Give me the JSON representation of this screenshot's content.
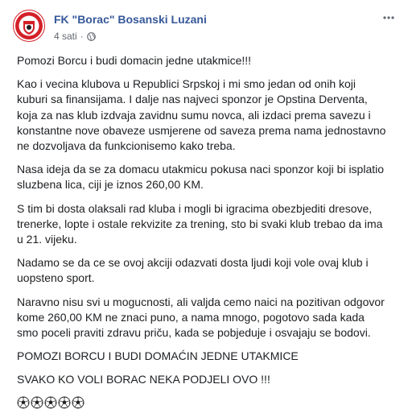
{
  "post": {
    "author": "FK \"Borac\" Bosanski Luzani",
    "time": "4 sati",
    "separator": "·",
    "paragraphs": [
      "Pomozi Borcu i budi domacin jedne utakmice!!!",
      "Kao i vecina klubova u Republici Srpskoj i mi smo jedan od onih koji kuburi sa finansijama. I dalje nas najveci sponzor je Opstina Derventa, koja za nas klub izdvaja zavidnu sumu novca, ali izdaci prema savezu i konstantne nove obaveze usmjerene od saveza prema nama jednostavno ne dozvoljava da funkcionisemo kako treba.",
      "Nasa ideja da se za domacu utakmicu pokusa naci sponzor koji bi isplatio sluzbena lica, ciji je iznos 260,00 KM.",
      "S tim bi dosta olaksali rad kluba i mogli bi igracima obezbjediti dresove, trenerke, lopte i ostale rekvizite za trening, sto bi svaki klub trebao da ima u 21. vijeku.",
      "Nadamo se da ce se ovoj akciji odazvati dosta ljudi koji vole ovaj klub i uopsteno sport.",
      "Naravno nisu svi u mogucnosti, ali valjda cemo naici na pozitivan odgovor kome 260,00 KM ne znaci puno, a nama mnogo, pogotovo sada kada smo poceli praviti zdravu priču, kada se pobjeduje i osvajaju se bodovi.",
      "POMOZI BORCU I BUDI DOMAĆIN JEDNE UTAKMICE",
      "SVAKO KO VOLI BORAC NEKA PODJELI OVO !!!"
    ],
    "emoji_count": 5
  },
  "icons": {
    "avatar": "club-crest",
    "privacy": "globe-icon",
    "menu": "more-options-icon",
    "emoji": "soccer-ball-icon"
  },
  "colors": {
    "author": "#365899",
    "meta": "#616770",
    "text": "#1c1e21",
    "crest_red": "#d32027"
  }
}
